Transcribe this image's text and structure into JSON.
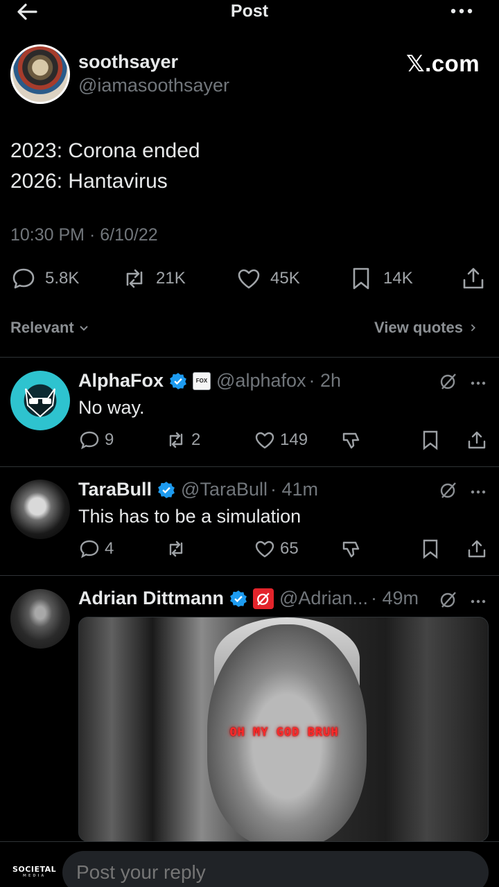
{
  "header": {
    "title": "Post"
  },
  "post": {
    "author_name": "soothsayer",
    "author_handle": "@iamasoothsayer",
    "watermark": "𝕏.com",
    "lines": [
      "2023: Corona ended",
      "2026: Hantavirus"
    ],
    "timestamp": "10:30 PM · 6/10/22",
    "stats": {
      "replies": "5.8K",
      "reposts": "21K",
      "likes": "45K",
      "bookmarks": "14K"
    }
  },
  "filters": {
    "sort_label": "Relevant",
    "quotes_label": "View quotes"
  },
  "replies": [
    {
      "name": "AlphaFox",
      "handle": "@alphafox",
      "time": "· 2h",
      "text": "No way.",
      "replies": "9",
      "reposts": "2",
      "likes": "149",
      "badge_text": "FOX"
    },
    {
      "name": "TaraBull",
      "handle": "@TaraBull",
      "time": "· 41m",
      "text": "This has to be a simulation",
      "replies": "4",
      "reposts": "",
      "likes": "65"
    },
    {
      "name": "Adrian Dittmann",
      "handle": "@Adrian...",
      "time": "· 49m",
      "media_caption": "OH MY GOD BRUH"
    }
  ],
  "composer": {
    "placeholder": "Post your reply",
    "logo_text": "SOCIETAL",
    "logo_sub": "MEDIA"
  },
  "colors": {
    "verified": "#1d9bf0",
    "accent_red": "#e3242b",
    "background": "#000000"
  }
}
